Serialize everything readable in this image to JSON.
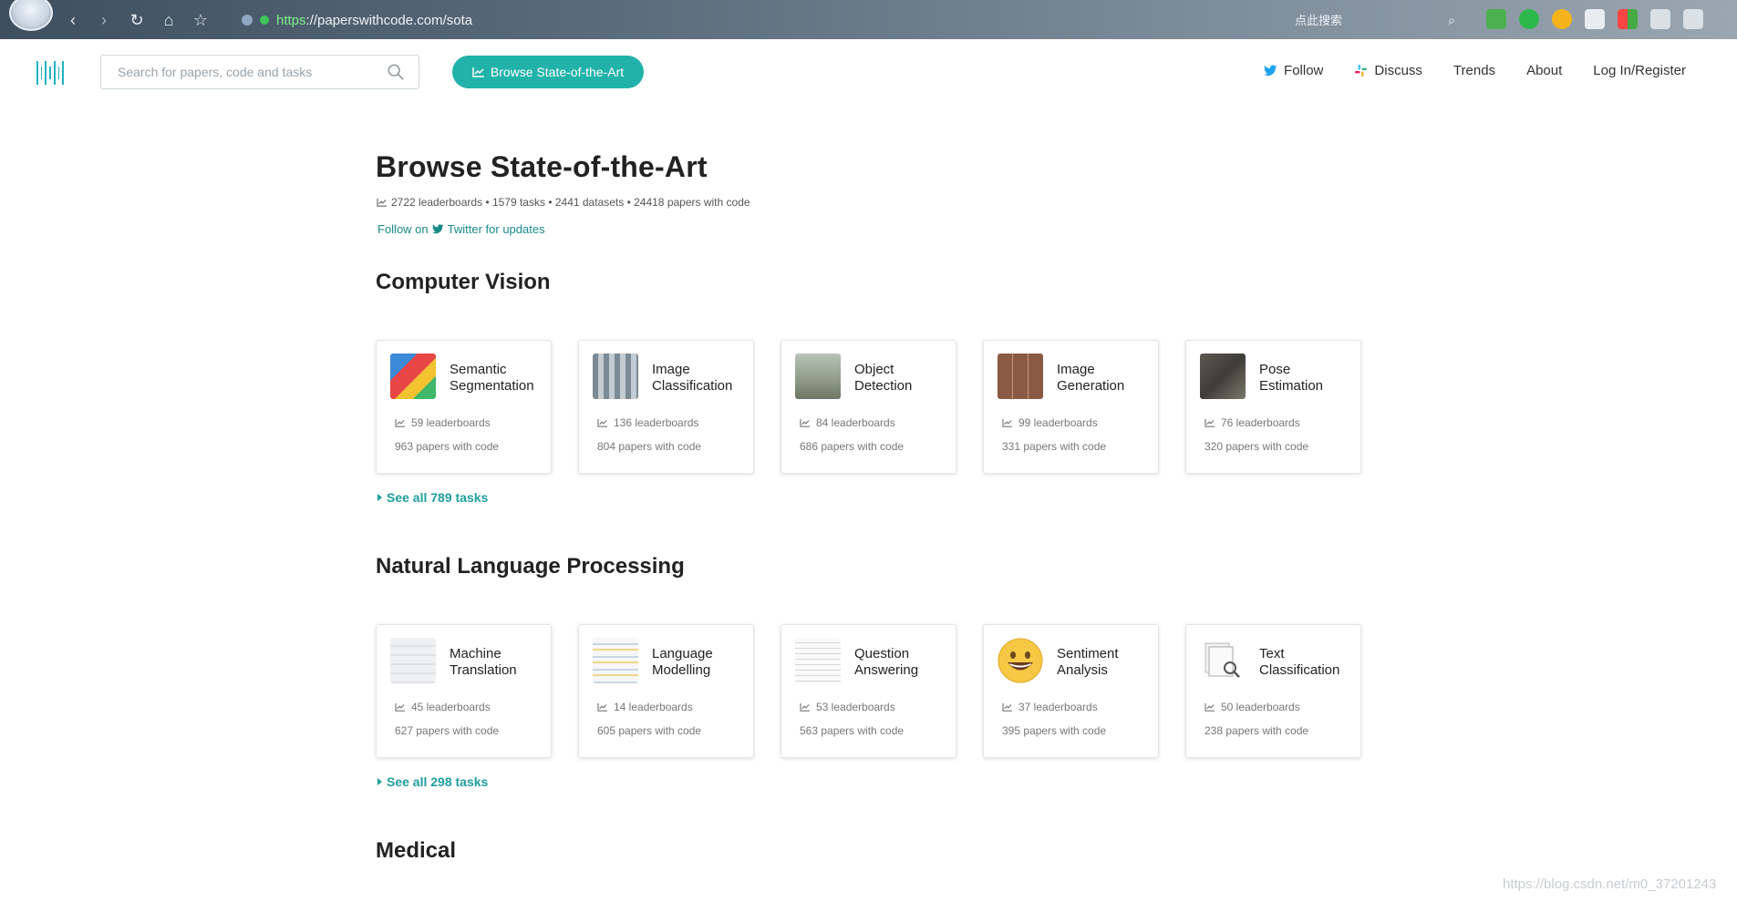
{
  "browser": {
    "url_protocol": "https",
    "url_rest": "://paperswithcode.com/sota",
    "search_placeholder": "点此搜索"
  },
  "navbar": {
    "search_placeholder": "Search for papers, code and tasks",
    "browse_button": "Browse State-of-the-Art",
    "links": {
      "follow": "Follow",
      "discuss": "Discuss",
      "trends": "Trends",
      "about": "About",
      "login": "Log In/Register"
    }
  },
  "page": {
    "title": "Browse State-of-the-Art",
    "stats": "2722 leaderboards • 1579 tasks • 2441 datasets • 24418 papers with code",
    "follow_prefix": "Follow on",
    "follow_suffix": "Twitter for updates"
  },
  "sections": [
    {
      "title": "Computer Vision",
      "see_all": "See all 789 tasks",
      "cards": [
        {
          "name": "Semantic Segmentation",
          "leaderboards": "59 leaderboards",
          "papers": "963 papers with code"
        },
        {
          "name": "Image Classification",
          "leaderboards": "136 leaderboards",
          "papers": "804 papers with code"
        },
        {
          "name": "Object Detection",
          "leaderboards": "84 leaderboards",
          "papers": "686 papers with code"
        },
        {
          "name": "Image Generation",
          "leaderboards": "99 leaderboards",
          "papers": "331 papers with code"
        },
        {
          "name": "Pose Estimation",
          "leaderboards": "76 leaderboards",
          "papers": "320 papers with code"
        }
      ]
    },
    {
      "title": "Natural Language Processing",
      "see_all": "See all 298 tasks",
      "cards": [
        {
          "name": "Machine Translation",
          "leaderboards": "45 leaderboards",
          "papers": "627 papers with code"
        },
        {
          "name": "Language Modelling",
          "leaderboards": "14 leaderboards",
          "papers": "605 papers with code"
        },
        {
          "name": "Question Answering",
          "leaderboards": "53 leaderboards",
          "papers": "563 papers with code"
        },
        {
          "name": "Sentiment Analysis",
          "leaderboards": "37 leaderboards",
          "papers": "395 papers with code"
        },
        {
          "name": "Text Classification",
          "leaderboards": "50 leaderboards",
          "papers": "238 papers with code"
        }
      ]
    },
    {
      "title": "Medical"
    }
  ],
  "watermark": "https://blog.csdn.net/m0_37201243",
  "colors": {
    "accent": "#21b2a9",
    "link": "#1f9e9e",
    "twitter": "#1da1f2"
  }
}
